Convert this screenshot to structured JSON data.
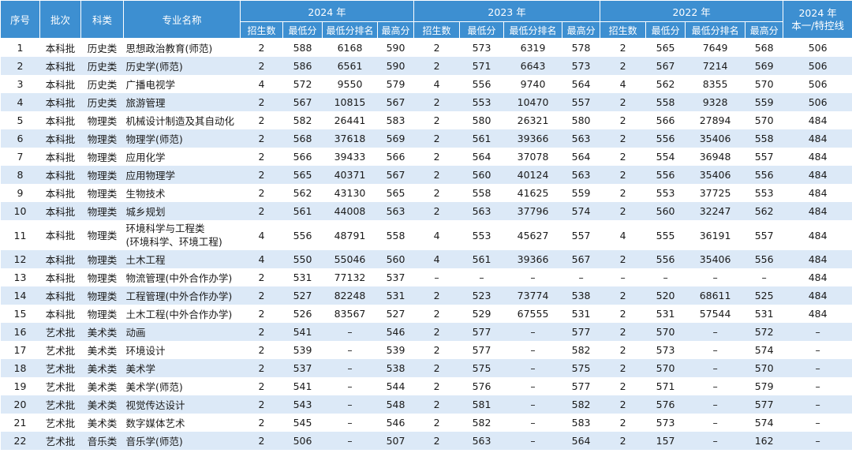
{
  "header": {
    "seq": "序号",
    "batch": "批次",
    "category": "科类",
    "major": "专业名称",
    "years": [
      "2024 年",
      "2023 年",
      "2022 年"
    ],
    "subcols": [
      "招生数",
      "最低分",
      "最低分排名",
      "最高分"
    ],
    "control_line": [
      "2024 年",
      "本一/特控线"
    ]
  },
  "rows": [
    {
      "seq": "1",
      "batch": "本科批",
      "cat": "历史类",
      "major": [
        "思想政治教育(师范)"
      ],
      "y2024": [
        "2",
        "588",
        "6168",
        "590"
      ],
      "y2023": [
        "2",
        "573",
        "6319",
        "578"
      ],
      "y2022": [
        "2",
        "565",
        "7649",
        "568"
      ],
      "line": "506"
    },
    {
      "seq": "2",
      "batch": "本科批",
      "cat": "历史类",
      "major": [
        "历史学(师范)"
      ],
      "y2024": [
        "2",
        "586",
        "6561",
        "590"
      ],
      "y2023": [
        "2",
        "571",
        "6643",
        "573"
      ],
      "y2022": [
        "2",
        "567",
        "7214",
        "569"
      ],
      "line": "506"
    },
    {
      "seq": "3",
      "batch": "本科批",
      "cat": "历史类",
      "major": [
        "广播电视学"
      ],
      "y2024": [
        "4",
        "572",
        "9550",
        "579"
      ],
      "y2023": [
        "4",
        "556",
        "9740",
        "564"
      ],
      "y2022": [
        "4",
        "562",
        "8355",
        "570"
      ],
      "line": "506"
    },
    {
      "seq": "4",
      "batch": "本科批",
      "cat": "历史类",
      "major": [
        "旅游管理"
      ],
      "y2024": [
        "2",
        "567",
        "10815",
        "567"
      ],
      "y2023": [
        "2",
        "553",
        "10470",
        "557"
      ],
      "y2022": [
        "2",
        "558",
        "9328",
        "559"
      ],
      "line": "506"
    },
    {
      "seq": "5",
      "batch": "本科批",
      "cat": "物理类",
      "major": [
        "机械设计制造及其自动化"
      ],
      "y2024": [
        "2",
        "582",
        "26441",
        "583"
      ],
      "y2023": [
        "2",
        "580",
        "26321",
        "580"
      ],
      "y2022": [
        "2",
        "566",
        "27894",
        "570"
      ],
      "line": "484"
    },
    {
      "seq": "6",
      "batch": "本科批",
      "cat": "物理类",
      "major": [
        "物理学(师范)"
      ],
      "y2024": [
        "2",
        "568",
        "37618",
        "569"
      ],
      "y2023": [
        "2",
        "561",
        "39366",
        "563"
      ],
      "y2022": [
        "2",
        "556",
        "35406",
        "558"
      ],
      "line": "484"
    },
    {
      "seq": "7",
      "batch": "本科批",
      "cat": "物理类",
      "major": [
        "应用化学"
      ],
      "y2024": [
        "2",
        "566",
        "39433",
        "566"
      ],
      "y2023": [
        "2",
        "564",
        "37078",
        "564"
      ],
      "y2022": [
        "2",
        "554",
        "36948",
        "557"
      ],
      "line": "484"
    },
    {
      "seq": "8",
      "batch": "本科批",
      "cat": "物理类",
      "major": [
        "应用物理学"
      ],
      "y2024": [
        "2",
        "565",
        "40371",
        "567"
      ],
      "y2023": [
        "2",
        "560",
        "40124",
        "563"
      ],
      "y2022": [
        "2",
        "556",
        "35406",
        "556"
      ],
      "line": "484"
    },
    {
      "seq": "9",
      "batch": "本科批",
      "cat": "物理类",
      "major": [
        "生物技术"
      ],
      "y2024": [
        "2",
        "562",
        "43130",
        "565"
      ],
      "y2023": [
        "2",
        "558",
        "41625",
        "559"
      ],
      "y2022": [
        "2",
        "553",
        "37725",
        "553"
      ],
      "line": "484"
    },
    {
      "seq": "10",
      "batch": "本科批",
      "cat": "物理类",
      "major": [
        "城乡规划"
      ],
      "y2024": [
        "2",
        "561",
        "44008",
        "563"
      ],
      "y2023": [
        "2",
        "563",
        "37796",
        "574"
      ],
      "y2022": [
        "2",
        "560",
        "32247",
        "562"
      ],
      "line": "484"
    },
    {
      "seq": "11",
      "batch": "本科批",
      "cat": "物理类",
      "major": [
        "环境科学与工程类",
        "(环境科学、环境工程)"
      ],
      "y2024": [
        "4",
        "556",
        "48791",
        "558"
      ],
      "y2023": [
        "4",
        "553",
        "45627",
        "557"
      ],
      "y2022": [
        "4",
        "555",
        "36191",
        "557"
      ],
      "line": "484"
    },
    {
      "seq": "12",
      "batch": "本科批",
      "cat": "物理类",
      "major": [
        "土木工程"
      ],
      "y2024": [
        "4",
        "550",
        "55046",
        "560"
      ],
      "y2023": [
        "4",
        "561",
        "39366",
        "567"
      ],
      "y2022": [
        "2",
        "556",
        "35406",
        "556"
      ],
      "line": "484"
    },
    {
      "seq": "13",
      "batch": "本科批",
      "cat": "物理类",
      "major": [
        "物流管理(中外合作办学)"
      ],
      "y2024": [
        "2",
        "531",
        "77132",
        "537"
      ],
      "y2023": [
        "–",
        "–",
        "–",
        "–"
      ],
      "y2022": [
        "–",
        "–",
        "–",
        "–"
      ],
      "line": "484"
    },
    {
      "seq": "14",
      "batch": "本科批",
      "cat": "物理类",
      "major": [
        "工程管理(中外合作办学)"
      ],
      "y2024": [
        "2",
        "527",
        "82248",
        "531"
      ],
      "y2023": [
        "2",
        "523",
        "73774",
        "538"
      ],
      "y2022": [
        "2",
        "520",
        "68611",
        "525"
      ],
      "line": "484"
    },
    {
      "seq": "15",
      "batch": "本科批",
      "cat": "物理类",
      "major": [
        "土木工程(中外合作办学)"
      ],
      "y2024": [
        "2",
        "526",
        "83567",
        "527"
      ],
      "y2023": [
        "2",
        "529",
        "67555",
        "531"
      ],
      "y2022": [
        "2",
        "531",
        "57544",
        "531"
      ],
      "line": "484"
    },
    {
      "seq": "16",
      "batch": "艺术批",
      "cat": "美术类",
      "major": [
        "动画"
      ],
      "y2024": [
        "2",
        "541",
        "–",
        "546"
      ],
      "y2023": [
        "2",
        "577",
        "–",
        "577"
      ],
      "y2022": [
        "2",
        "570",
        "–",
        "572"
      ],
      "line": "–"
    },
    {
      "seq": "17",
      "batch": "艺术批",
      "cat": "美术类",
      "major": [
        "环境设计"
      ],
      "y2024": [
        "2",
        "539",
        "–",
        "539"
      ],
      "y2023": [
        "2",
        "577",
        "–",
        "582"
      ],
      "y2022": [
        "2",
        "573",
        "–",
        "574"
      ],
      "line": "–"
    },
    {
      "seq": "18",
      "batch": "艺术批",
      "cat": "美术类",
      "major": [
        "美术学"
      ],
      "y2024": [
        "2",
        "537",
        "–",
        "538"
      ],
      "y2023": [
        "2",
        "575",
        "–",
        "575"
      ],
      "y2022": [
        "2",
        "570",
        "–",
        "570"
      ],
      "line": "–"
    },
    {
      "seq": "19",
      "batch": "艺术批",
      "cat": "美术类",
      "major": [
        "美术学(师范)"
      ],
      "y2024": [
        "2",
        "541",
        "–",
        "544"
      ],
      "y2023": [
        "2",
        "576",
        "–",
        "577"
      ],
      "y2022": [
        "2",
        "571",
        "–",
        "579"
      ],
      "line": "–"
    },
    {
      "seq": "20",
      "batch": "艺术批",
      "cat": "美术类",
      "major": [
        "视觉传达设计"
      ],
      "y2024": [
        "2",
        "543",
        "–",
        "548"
      ],
      "y2023": [
        "2",
        "581",
        "–",
        "582"
      ],
      "y2022": [
        "2",
        "576",
        "–",
        "577"
      ],
      "line": "–"
    },
    {
      "seq": "21",
      "batch": "艺术批",
      "cat": "美术类",
      "major": [
        "数字媒体艺术"
      ],
      "y2024": [
        "2",
        "545",
        "–",
        "546"
      ],
      "y2023": [
        "2",
        "582",
        "–",
        "583"
      ],
      "y2022": [
        "2",
        "573",
        "–",
        "574"
      ],
      "line": "–"
    },
    {
      "seq": "22",
      "batch": "艺术批",
      "cat": "音乐类",
      "major": [
        "音乐学(师范)"
      ],
      "y2024": [
        "2",
        "506",
        "–",
        "507"
      ],
      "y2023": [
        "2",
        "563",
        "–",
        "564"
      ],
      "y2022": [
        "2",
        "157",
        "–",
        "162"
      ],
      "line": "–"
    }
  ]
}
